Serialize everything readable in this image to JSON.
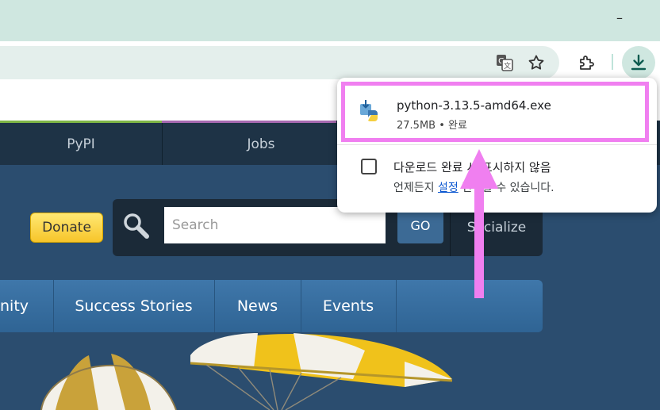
{
  "window": {
    "minimize_glyph": "–"
  },
  "toolbar": {
    "icons": [
      "translate-icon",
      "star-icon",
      "extensions-icon",
      "download-icon"
    ]
  },
  "site": {
    "top_nav": [
      "PyPI",
      "Jobs"
    ],
    "donate_label": "Donate",
    "search": {
      "placeholder": "Search",
      "go_label": "GO"
    },
    "socialize_label": "Socialize",
    "main_menu": [
      "nity",
      "Success Stories",
      "News",
      "Events"
    ]
  },
  "download_bubble": {
    "file_name": "python-3.13.5-amd64.exe",
    "size": "27.5MB",
    "status": "완료",
    "checkbox_label_a": "다운로드 완료",
    "checkbox_label_b": "시 표시하지 않음",
    "hint_a": "언제든지",
    "hint_link": "설정",
    "hint_b": "변경할 수 있습니다."
  },
  "colors": {
    "highlight": "#f07ff0",
    "arrow": "#f07ff0",
    "titlebar": "#cfe7e0",
    "site_bg": "#2b4d6f"
  }
}
